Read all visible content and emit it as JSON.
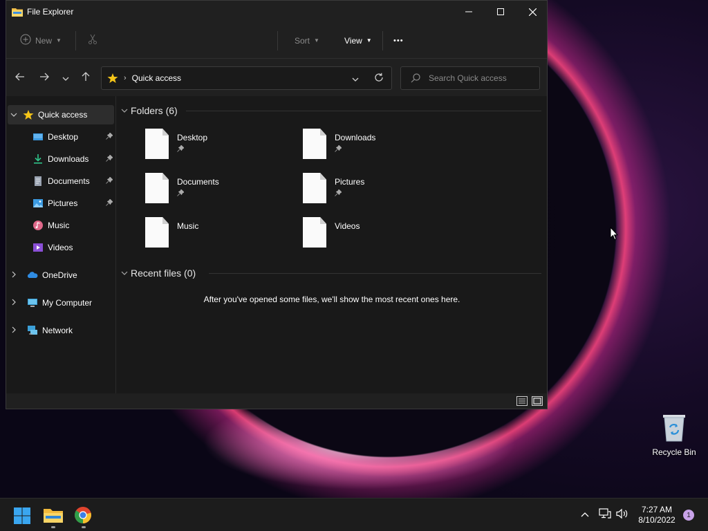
{
  "window": {
    "title": "File Explorer",
    "controls": {
      "minimize": "—",
      "maximize": "☐",
      "close": "✕"
    }
  },
  "toolbar": {
    "new_label": "New",
    "sort_label": "Sort",
    "view_label": "View",
    "more_label": "•••"
  },
  "address": {
    "location": "Quick access",
    "search_placeholder": "Search Quick access"
  },
  "sidebar": {
    "quick_access": "Quick access",
    "items": [
      {
        "label": "Desktop",
        "icon": "desktop-icon",
        "pinned": true
      },
      {
        "label": "Downloads",
        "icon": "downloads-icon",
        "pinned": true
      },
      {
        "label": "Documents",
        "icon": "documents-icon",
        "pinned": true
      },
      {
        "label": "Pictures",
        "icon": "pictures-icon",
        "pinned": true
      },
      {
        "label": "Music",
        "icon": "music-icon",
        "pinned": false
      },
      {
        "label": "Videos",
        "icon": "videos-icon",
        "pinned": false
      }
    ],
    "roots": [
      {
        "label": "OneDrive",
        "icon": "onedrive-icon"
      },
      {
        "label": "My Computer",
        "icon": "computer-icon"
      },
      {
        "label": "Network",
        "icon": "network-icon"
      }
    ]
  },
  "content": {
    "folders_header": "Folders (6)",
    "folders": [
      {
        "name": "Desktop",
        "pinned": true
      },
      {
        "name": "Downloads",
        "pinned": true
      },
      {
        "name": "Documents",
        "pinned": true
      },
      {
        "name": "Pictures",
        "pinned": true
      },
      {
        "name": "Music",
        "pinned": false
      },
      {
        "name": "Videos",
        "pinned": false
      }
    ],
    "recent_header": "Recent files (0)",
    "recent_empty_message": "After you've opened some files, we'll show the most recent ones here."
  },
  "desktop": {
    "recycle_bin_label": "Recycle Bin"
  },
  "taskbar": {
    "time": "7:27 AM",
    "date": "8/10/2022",
    "notification_count": "1"
  },
  "colors": {
    "window_bg": "#202020",
    "content_bg": "#191919",
    "accent_star": "#f5c518",
    "notification_badge": "#c8a2e8"
  }
}
